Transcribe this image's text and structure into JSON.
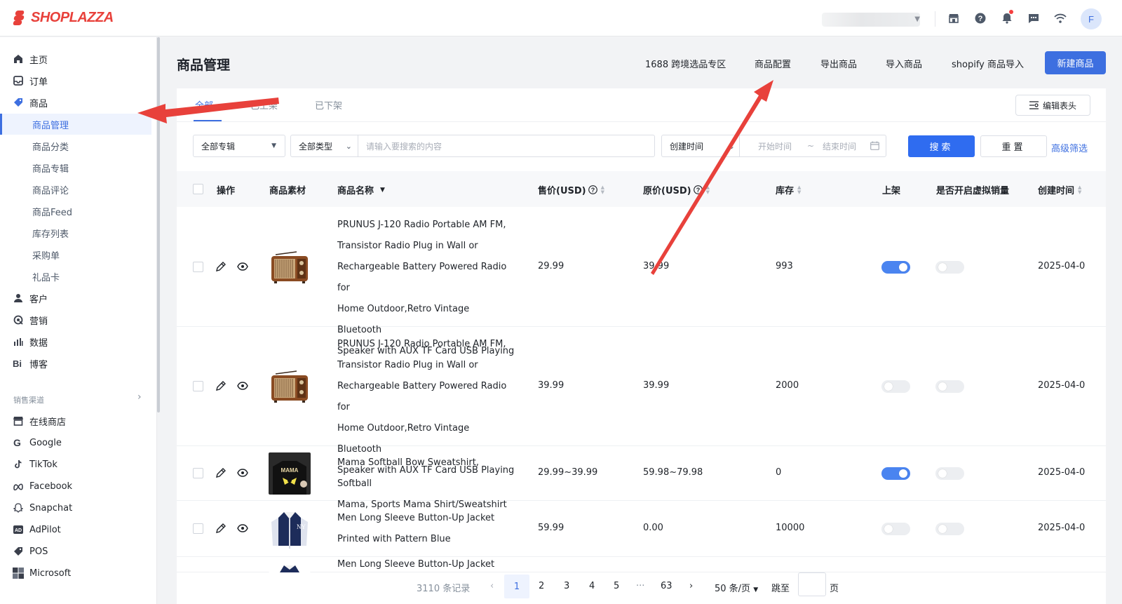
{
  "app": {
    "brand": "SHOPLAZZA",
    "avatar_initial": "F"
  },
  "topbar": {
    "icons": [
      "store-icon",
      "help-icon",
      "bell-icon",
      "chat-icon",
      "wifi-icon"
    ]
  },
  "sidebar": {
    "main_items": [
      {
        "label": "主页",
        "icon": "home-icon"
      },
      {
        "label": "订单",
        "icon": "order-icon"
      },
      {
        "label": "商品",
        "icon": "tag-icon"
      }
    ],
    "product_sub": [
      "商品管理",
      "商品分类",
      "商品专辑",
      "商品评论",
      "商品Feed",
      "库存列表",
      "采购单",
      "礼品卡"
    ],
    "more_items": [
      {
        "label": "客户",
        "icon": "user-icon"
      },
      {
        "label": "营销",
        "icon": "marketing-icon"
      },
      {
        "label": "数据",
        "icon": "chart-icon"
      },
      {
        "label": "博客",
        "icon": "blog-icon"
      }
    ],
    "section_label": "销售渠道",
    "channels": [
      {
        "label": "在线商店",
        "icon": "store-icon"
      },
      {
        "label": "Google",
        "icon": "google-icon"
      },
      {
        "label": "TikTok",
        "icon": "tiktok-icon"
      },
      {
        "label": "Facebook",
        "icon": "meta-icon"
      },
      {
        "label": "Snapchat",
        "icon": "snapchat-icon"
      },
      {
        "label": "AdPilot",
        "icon": "adpilot-icon"
      },
      {
        "label": "POS",
        "icon": "pos-icon"
      },
      {
        "label": "Microsoft",
        "icon": "microsoft-icon"
      }
    ]
  },
  "header": {
    "title": "商品管理",
    "links": [
      "1688 跨境选品专区",
      "商品配置",
      "导出商品",
      "导入商品",
      "shopify 商品导入"
    ],
    "primary_button": "新建商品"
  },
  "tabs": [
    "全部",
    "已上架",
    "已下架"
  ],
  "edit_columns_label": "编辑表头",
  "filters": {
    "collection": "全部专辑",
    "type": "全部类型",
    "search_placeholder": "请输入要搜索的内容",
    "date_field": "创建时间",
    "start_placeholder": "开始时间",
    "range_sep": "~",
    "end_placeholder": "结束时间",
    "search_button": "搜索",
    "reset_button": "重置",
    "advanced": "高级筛选"
  },
  "table": {
    "columns": [
      "操作",
      "商品素材",
      "商品名称",
      "售价(USD)",
      "原价(USD)",
      "库存",
      "上架",
      "是否开启虚拟销量",
      "创建时间"
    ],
    "rows": [
      {
        "name": [
          "PRUNUS J-120 Radio Portable AM FM,",
          "Transistor Radio Plug in Wall or",
          "Rechargeable Battery Powered Radio for",
          "Home Outdoor,Retro Vintage Bluetooth",
          "Speaker with AUX TF Card USB Playing"
        ],
        "price": "29.99",
        "original": "39.99",
        "stock": "993",
        "listed": true,
        "virtual": false,
        "created": "2025-04-0",
        "thumb": "radio"
      },
      {
        "name": [
          "PRUNUS J-120 Radio Portable AM FM,",
          "Transistor Radio Plug in Wall or",
          "Rechargeable Battery Powered Radio for",
          "Home Outdoor,Retro Vintage Bluetooth",
          "Speaker with AUX TF Card USB Playing"
        ],
        "price": "39.99",
        "original": "39.99",
        "stock": "2000",
        "listed": false,
        "virtual": false,
        "created": "2025-04-0",
        "thumb": "radio"
      },
      {
        "name": [
          "Mama Softball Bow Sweatshirt, Softball",
          "Mama, Sports Mama Shirt/Sweatshirt"
        ],
        "price": "29.99~39.99",
        "original": "59.98~79.98",
        "stock": "0",
        "listed": true,
        "virtual": false,
        "created": "2025-04-0",
        "thumb": "shirt"
      },
      {
        "name": [
          "Men Long Sleeve Button-Up Jacket",
          "Printed with Pattern Blue"
        ],
        "price": "59.99",
        "original": "0.00",
        "stock": "10000",
        "listed": false,
        "virtual": false,
        "created": "2025-04-0",
        "thumb": "jacket"
      },
      {
        "name": [
          "Men Long Sleeve Button-Up Jacket"
        ],
        "thumb": "jacket2"
      }
    ]
  },
  "pagination": {
    "total": "3110 条记录",
    "pages": [
      "1",
      "2",
      "3",
      "4",
      "5",
      "···",
      "63"
    ],
    "current": "1",
    "page_size": "50 条/页",
    "jump_label": "跳至",
    "page_suffix": "页"
  },
  "colors": {
    "brand": "#e8413b",
    "primary": "#3d6fe0",
    "annotation": "#e8413b"
  }
}
